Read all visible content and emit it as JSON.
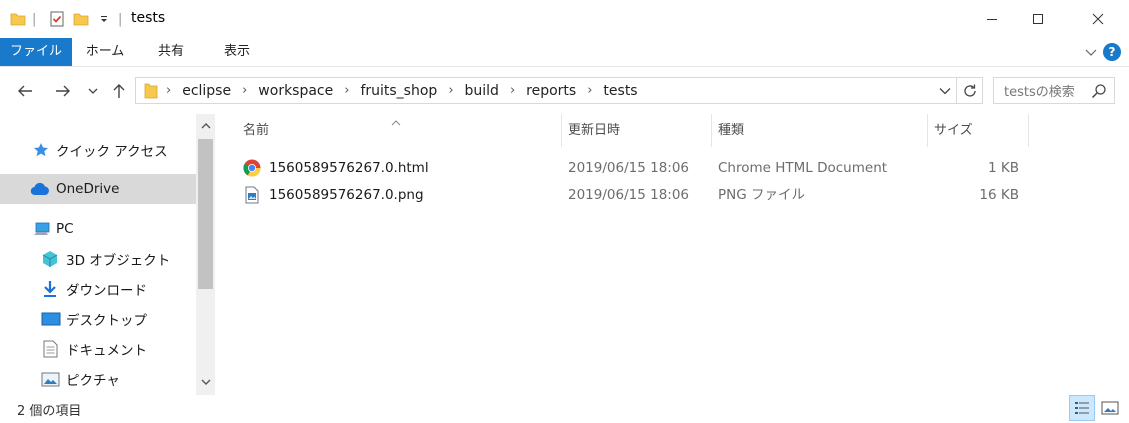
{
  "window": {
    "title": "tests",
    "minimize_label": "─",
    "maximize_label": "☐",
    "close_label": "✕"
  },
  "ribbon": {
    "tabs": [
      {
        "label": "ファイル"
      },
      {
        "label": "ホーム"
      },
      {
        "label": "共有"
      },
      {
        "label": "表示"
      }
    ],
    "help_label": "?"
  },
  "address": {
    "breadcrumbs": [
      "eclipse",
      "workspace",
      "fruits_shop",
      "build",
      "reports",
      "tests"
    ],
    "search_placeholder": "testsの検索"
  },
  "navpane": {
    "items": [
      {
        "label": "クイック アクセス",
        "icon": "star-icon"
      },
      {
        "label": "OneDrive",
        "icon": "cloud-icon"
      },
      {
        "label": "PC",
        "icon": "computer-icon"
      },
      {
        "label": "3D オブジェクト",
        "icon": "cube-icon"
      },
      {
        "label": "ダウンロード",
        "icon": "download-icon"
      },
      {
        "label": "デスクトップ",
        "icon": "desktop-icon"
      },
      {
        "label": "ドキュメント",
        "icon": "document-icon"
      },
      {
        "label": "ピクチャ",
        "icon": "picture-icon"
      }
    ],
    "selected": "OneDrive"
  },
  "filelist": {
    "columns": [
      {
        "label": "名前"
      },
      {
        "label": "更新日時"
      },
      {
        "label": "種類"
      },
      {
        "label": "サイズ"
      }
    ],
    "rows": [
      {
        "name": "1560589576267.0.html",
        "modified": "2019/06/15 18:06",
        "type": "Chrome HTML Document",
        "size": "1 KB",
        "icon": "chrome-icon"
      },
      {
        "name": "1560589576267.0.png",
        "modified": "2019/06/15 18:06",
        "type": "PNG ファイル",
        "size": "16 KB",
        "icon": "png-image-icon"
      }
    ]
  },
  "statusbar": {
    "item_count": "2 個の項目"
  },
  "colors": {
    "accent": "#1979ca",
    "selected_nav": "#d9d9d9",
    "folder": "#f8c74e"
  }
}
